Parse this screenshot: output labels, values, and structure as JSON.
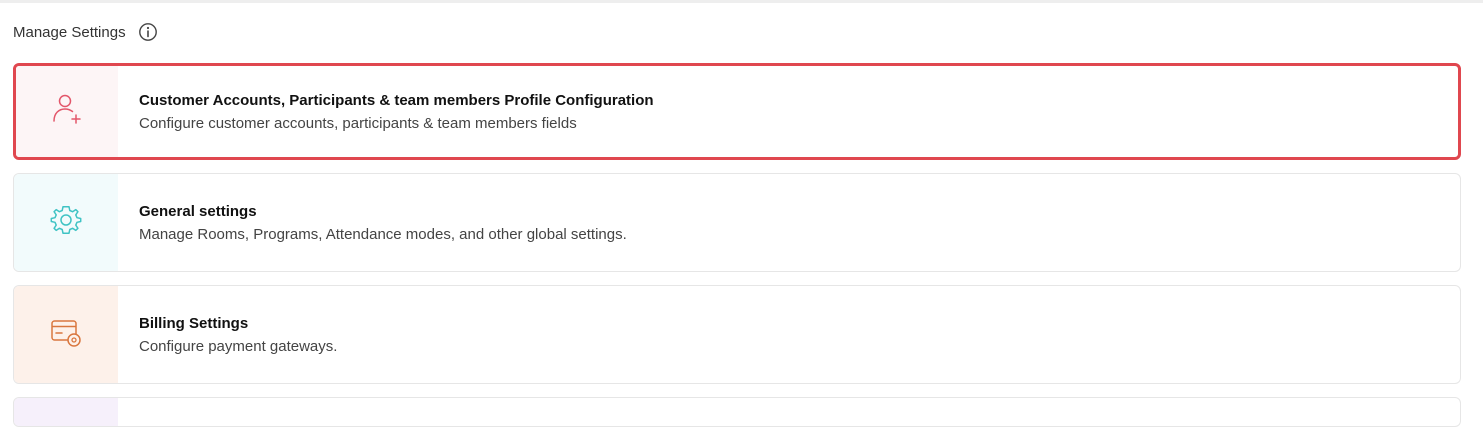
{
  "header": {
    "title": "Manage Settings",
    "info_icon": "info-icon"
  },
  "cards": [
    {
      "title": "Customer Accounts, Participants & team members Profile Configuration",
      "description": "Configure customer accounts, participants & team members fields",
      "icon": "add-user-icon",
      "icon_color": "#e3566a",
      "icon_bg": "#fdf5f6",
      "selected": true
    },
    {
      "title": "General settings",
      "description": "Manage Rooms, Programs, Attendance modes, and other global settings.",
      "icon": "gear-icon",
      "icon_color": "#3fc3c4",
      "icon_bg": "#f2fbfc"
    },
    {
      "title": "Billing Settings",
      "description": "Configure payment gateways.",
      "icon": "billing-settings-icon",
      "icon_color": "#d9773f",
      "icon_bg": "#fdf1ea"
    }
  ],
  "colors": {
    "selected_border": "#e0474f",
    "card_border": "#e6e6e6"
  }
}
